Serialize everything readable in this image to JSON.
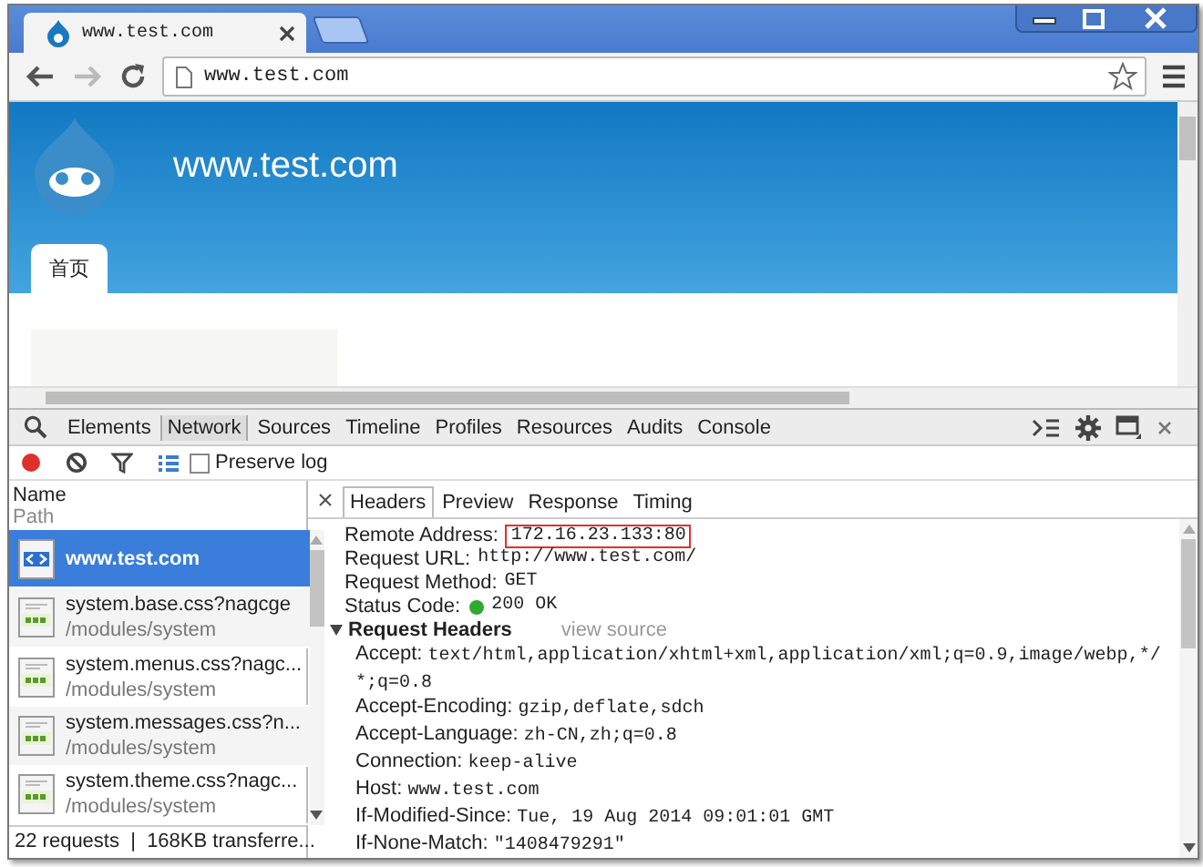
{
  "browser": {
    "tab_title": "www.test.com",
    "address": "www.test.com",
    "back_enabled": true,
    "forward_enabled": false
  },
  "page": {
    "site_title": "www.test.com",
    "nav_tabs": [
      {
        "label": "首页",
        "selected": true
      }
    ]
  },
  "devtools": {
    "panels": [
      {
        "label": "Elements",
        "selected": false
      },
      {
        "label": "Network",
        "selected": true
      },
      {
        "label": "Sources",
        "selected": false
      },
      {
        "label": "Timeline",
        "selected": false
      },
      {
        "label": "Profiles",
        "selected": false
      },
      {
        "label": "Resources",
        "selected": false
      },
      {
        "label": "Audits",
        "selected": false
      },
      {
        "label": "Console",
        "selected": false
      }
    ],
    "recording": true,
    "preserve_log": {
      "label": "Preserve log",
      "checked": false
    }
  },
  "requests": {
    "name_header": "Name",
    "path_header": "Path",
    "rows": [
      {
        "kind": "html",
        "name": "www.test.com",
        "path": "",
        "selected": true
      },
      {
        "kind": "css",
        "name": "system.base.css?nagcge",
        "path": "/modules/system",
        "selected": false
      },
      {
        "kind": "css",
        "name": "system.menus.css?nagc...",
        "path": "/modules/system",
        "selected": false
      },
      {
        "kind": "css",
        "name": "system.messages.css?n...",
        "path": "/modules/system",
        "selected": false
      },
      {
        "kind": "css",
        "name": "system.theme.css?nagc...",
        "path": "/modules/system",
        "selected": false
      }
    ],
    "summary": "22 requests  |  168KB transferre..."
  },
  "detail": {
    "tabs": [
      {
        "label": "Headers",
        "selected": true
      },
      {
        "label": "Preview",
        "selected": false
      },
      {
        "label": "Response",
        "selected": false
      },
      {
        "label": "Timing",
        "selected": false
      }
    ],
    "general": [
      {
        "kind": "plain",
        "label": "Remote Address:",
        "value": "172.16.23.133:80",
        "highlighted": true
      },
      {
        "kind": "plain",
        "label": "Request URL:",
        "value": "http://www.test.com/",
        "highlighted": false
      },
      {
        "kind": "plain",
        "label": "Request Method:",
        "value": "GET",
        "highlighted": false
      },
      {
        "kind": "status",
        "label": "Status Code:",
        "value": "200 OK",
        "highlighted": false
      }
    ],
    "request_headers": {
      "title": "Request Headers",
      "expanded": true,
      "link": "view source",
      "items": [
        {
          "name": "Accept:",
          "value": "text/html,application/xhtml+xml,application/xml;q=0.9,image/webp,*/*;q=0.8"
        },
        {
          "name": "Accept-Encoding:",
          "value": "gzip,deflate,sdch"
        },
        {
          "name": "Accept-Language:",
          "value": "zh-CN,zh;q=0.8"
        },
        {
          "name": "Connection:",
          "value": "keep-alive"
        },
        {
          "name": "Host:",
          "value": "www.test.com"
        },
        {
          "name": "If-Modified-Since:",
          "value": "Tue, 19 Aug 2014 09:01:01 GMT"
        },
        {
          "name": "If-None-Match:",
          "value": "\"1408479291\""
        }
      ]
    }
  }
}
